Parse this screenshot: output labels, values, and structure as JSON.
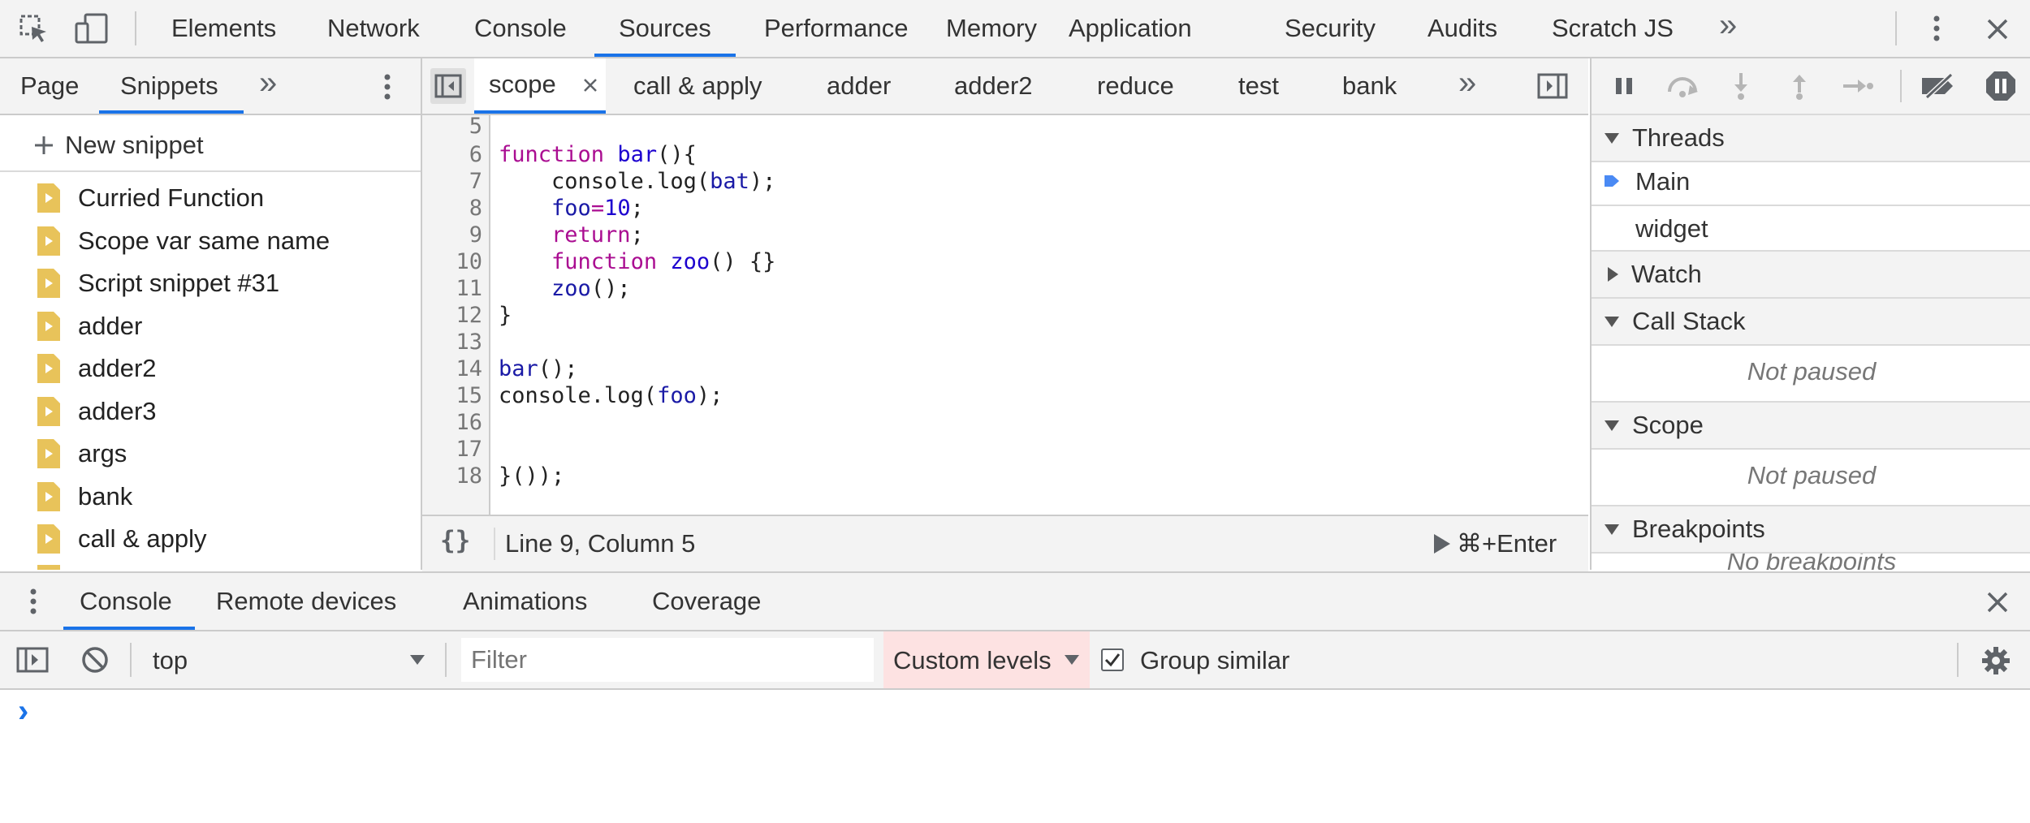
{
  "main_toolbar": {
    "tabs": [
      "Elements",
      "Network",
      "Console",
      "Sources",
      "Performance",
      "Memory",
      "Application",
      "Security",
      "Audits",
      "Scratch JS"
    ],
    "active_tab": "Sources",
    "more": "»"
  },
  "navigator": {
    "tabs": [
      "Page",
      "Snippets"
    ],
    "active_tab": "Snippets",
    "more": "»",
    "new_snippet": "New snippet",
    "snippets": [
      "Curried Function",
      "Scope var same name",
      "Script snippet #31",
      "adder",
      "adder2",
      "adder3",
      "args",
      "bank",
      "call & apply"
    ]
  },
  "editor": {
    "tabs": [
      "scope",
      "call & apply",
      "adder",
      "adder2",
      "reduce",
      "test",
      "bank"
    ],
    "active_tab": "scope",
    "more": "»",
    "line_numbers": [
      "5",
      "6",
      "7",
      "8",
      "9",
      "10",
      "11",
      "12",
      "13",
      "14",
      "15",
      "16",
      "17",
      "18"
    ],
    "code": {
      "l6_kw": "function",
      "l6_name": "bar",
      "l6_rest": "(){",
      "l7_a": "    console.log(",
      "l7_b": "bat",
      "l7_c": ");",
      "l8_a": "    ",
      "l8_b": "foo",
      "l8_c": "=",
      "l8_d": "10",
      "l8_e": ";",
      "l9_a": "    ",
      "l9_b": "return",
      "l9_c": ";",
      "l10_a": "    ",
      "l10_b": "function",
      "l10_c": " ",
      "l10_d": "zoo",
      "l10_e": "() {}",
      "l11_a": "    ",
      "l11_b": "zoo",
      "l11_c": "();",
      "l12": "}",
      "l14_a": "bar",
      "l14_b": "();",
      "l15_a": "console.log(",
      "l15_b": "foo",
      "l15_c": ");",
      "l18": "}());"
    },
    "status": {
      "format": "{}",
      "position": "Line 9, Column 5",
      "run": "⌘+Enter"
    }
  },
  "debugger": {
    "threads_title": "Threads",
    "threads": [
      "Main",
      "widget"
    ],
    "watch_title": "Watch",
    "callstack_title": "Call Stack",
    "callstack_status": "Not paused",
    "scope_title": "Scope",
    "scope_status": "Not paused",
    "breakpoints_title": "Breakpoints",
    "breakpoints_status": "No breakpoints"
  },
  "drawer": {
    "tabs": [
      "Console",
      "Remote devices",
      "Animations",
      "Coverage"
    ],
    "active_tab": "Console",
    "context": "top",
    "filter_placeholder": "Filter",
    "levels": "Custom levels",
    "group_similar": "Group similar",
    "group_similar_checked": true,
    "prompt": "›"
  },
  "colors": {
    "accent": "#1a73e8",
    "snippet_icon": "#e8c35a",
    "levels_bg": "#fde2e2"
  }
}
